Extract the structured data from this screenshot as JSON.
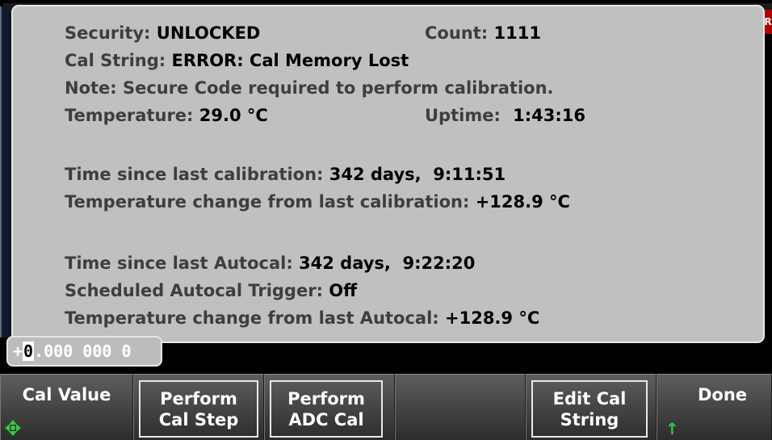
{
  "dialog": {
    "security": {
      "label": "Security:",
      "value": "UNLOCKED"
    },
    "count": {
      "label": "Count:",
      "value": "1111"
    },
    "cal_string": {
      "label": "Cal String:",
      "value": "ERROR: Cal Memory Lost"
    },
    "note": "Note: Secure Code required to perform calibration.",
    "temperature": {
      "label": "Temperature:",
      "value": "29.0 °C"
    },
    "uptime": {
      "label": "Uptime:",
      "value": "1:43:16"
    },
    "time_since_cal": {
      "label": "Time since last calibration:",
      "value": "342 days,  9:11:51"
    },
    "temp_change_cal": {
      "label": "Temperature change from last calibration:",
      "value": "+128.9 °C"
    },
    "time_since_autocal": {
      "label": "Time since last Autocal:",
      "value": "342 days,  9:22:20"
    },
    "scheduled_autocal": {
      "label": "Scheduled Autocal Trigger:",
      "value": "Off"
    },
    "temp_change_autocal": {
      "label": "Temperature change from last Autocal:",
      "value": "+128.9 °C"
    }
  },
  "entry": {
    "sign": "+",
    "cursor_digit": "0",
    "rest": ".000 000 0"
  },
  "softkeys": {
    "cal_value": "Cal Value",
    "perform_cal_step": {
      "line1": "Perform",
      "line2": "Cal Step"
    },
    "perform_adc_cal": {
      "line1": "Perform",
      "line2": "ADC Cal"
    },
    "edit_cal_string": {
      "line1": "Edit Cal",
      "line2": "String"
    },
    "done": "Done"
  },
  "colors": {
    "dialog_bg": "#c0c0c0",
    "accent_green": "#2ecc40",
    "alert_red": "#b00000"
  },
  "icons": {
    "cal_value_selector": "diamond-arrows-icon",
    "done_indicator": "up-arrow-icon"
  }
}
